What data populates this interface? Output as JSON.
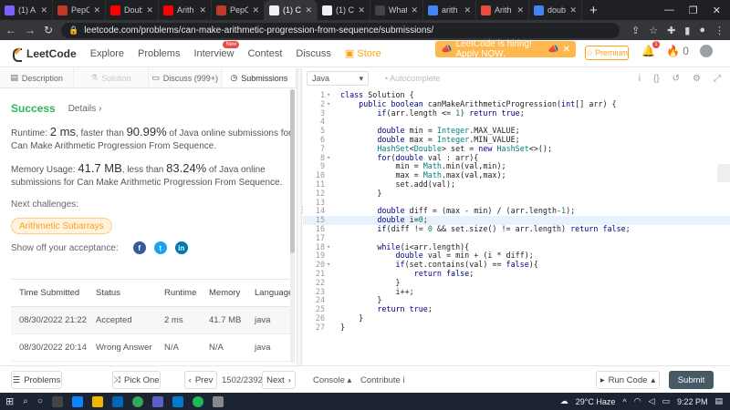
{
  "browser": {
    "tabs": [
      {
        "title": "(1) A",
        "color": "#7b61ff"
      },
      {
        "title": "PepC",
        "color": "#c0392b"
      },
      {
        "title": "Doub",
        "color": "#ff0000"
      },
      {
        "title": "Arith",
        "color": "#ff0000"
      },
      {
        "title": "PepC",
        "color": "#c0392b"
      },
      {
        "title": "(1) C",
        "color": "#f0f0f0"
      },
      {
        "title": "(1) C",
        "color": "#f0f0f0"
      },
      {
        "title": "What",
        "color": "#444444"
      },
      {
        "title": "arith",
        "color": "#4285f4"
      },
      {
        "title": "Arith",
        "color": "#e74c3c"
      },
      {
        "title": "doub",
        "color": "#4285f4"
      }
    ],
    "url": "leetcode.com/problems/can-make-arithmetic-progression-from-sequence/submissions/"
  },
  "header": {
    "logo_text": "LeetCode",
    "nav": [
      "Explore",
      "Problems",
      "Interview",
      "Contest",
      "Discuss"
    ],
    "new_badge": "New",
    "store": "Store",
    "hiring": "LeetCode is hiring! Apply NOW.",
    "premium": "Premium",
    "notif_count": "1",
    "points": "0"
  },
  "left_tabs": {
    "description": "Description",
    "solution": "Solution",
    "discuss": "Discuss (999+)",
    "submissions": "Submissions"
  },
  "result": {
    "status": "Success",
    "details": "Details",
    "runtime_prefix": "Runtime: ",
    "runtime_value": "2 ms",
    "runtime_mid": ", faster than ",
    "runtime_pct": "90.99%",
    "runtime_suffix": " of Java online submissions for Can Make Arithmetic Progression From Sequence.",
    "memory_prefix": "Memory Usage: ",
    "memory_value": "41.7 MB",
    "memory_mid": ", less than ",
    "memory_pct": "83.24%",
    "memory_suffix": " of Java online submissions for Can Make Arithmetic Progression From Sequence.",
    "next_challenges": "Next challenges:",
    "challenge": "Arithmetic Subarrays",
    "share_text": "Show off your acceptance:"
  },
  "submissions": {
    "headers": [
      "Time Submitted",
      "Status",
      "Runtime",
      "Memory",
      "Language"
    ],
    "rows": [
      {
        "time": "08/30/2022 21:22",
        "status": "Accepted",
        "runtime": "2 ms",
        "memory": "41.7 MB",
        "language": "java"
      },
      {
        "time": "08/30/2022 20:14",
        "status": "Wrong Answer",
        "runtime": "N/A",
        "memory": "N/A",
        "language": "java"
      }
    ]
  },
  "editor": {
    "language": "Java",
    "autocomplete": "Autocomplete",
    "highlight_line": 15,
    "lines": [
      "class Solution {",
      "    public boolean canMakeArithmeticProgression(int[] arr) {",
      "        if(arr.length <= 1) return true;",
      "",
      "        double min = Integer.MAX_VALUE;",
      "        double max = Integer.MIN_VALUE;",
      "        HashSet<Double> set = new HashSet<>();",
      "        for(double val : arr){",
      "            min = Math.min(val,min);",
      "            max = Math.max(val,max);",
      "            set.add(val);",
      "        }",
      "",
      "        double diff = (max - min) / (arr.length-1);",
      "        double i=0;",
      "        if(diff != 0 && set.size() != arr.length) return false;",
      "",
      "        while(i<arr.length){",
      "            double val = min + (i * diff);",
      "            if(set.contains(val) == false){",
      "                return false;",
      "            }",
      "            i++;",
      "        }",
      "        return true;",
      "    }",
      "}"
    ],
    "folds": [
      1,
      2,
      8,
      18,
      20
    ]
  },
  "bottom": {
    "problems": "Problems",
    "pick_one": "Pick One",
    "prev": "Prev",
    "page": "1502/2392",
    "next": "Next",
    "console": "Console",
    "contribute": "Contribute",
    "run_code": "Run Code",
    "submit": "Submit"
  },
  "taskbar": {
    "weather": "29°C  Haze",
    "time": "9:22 PM"
  }
}
